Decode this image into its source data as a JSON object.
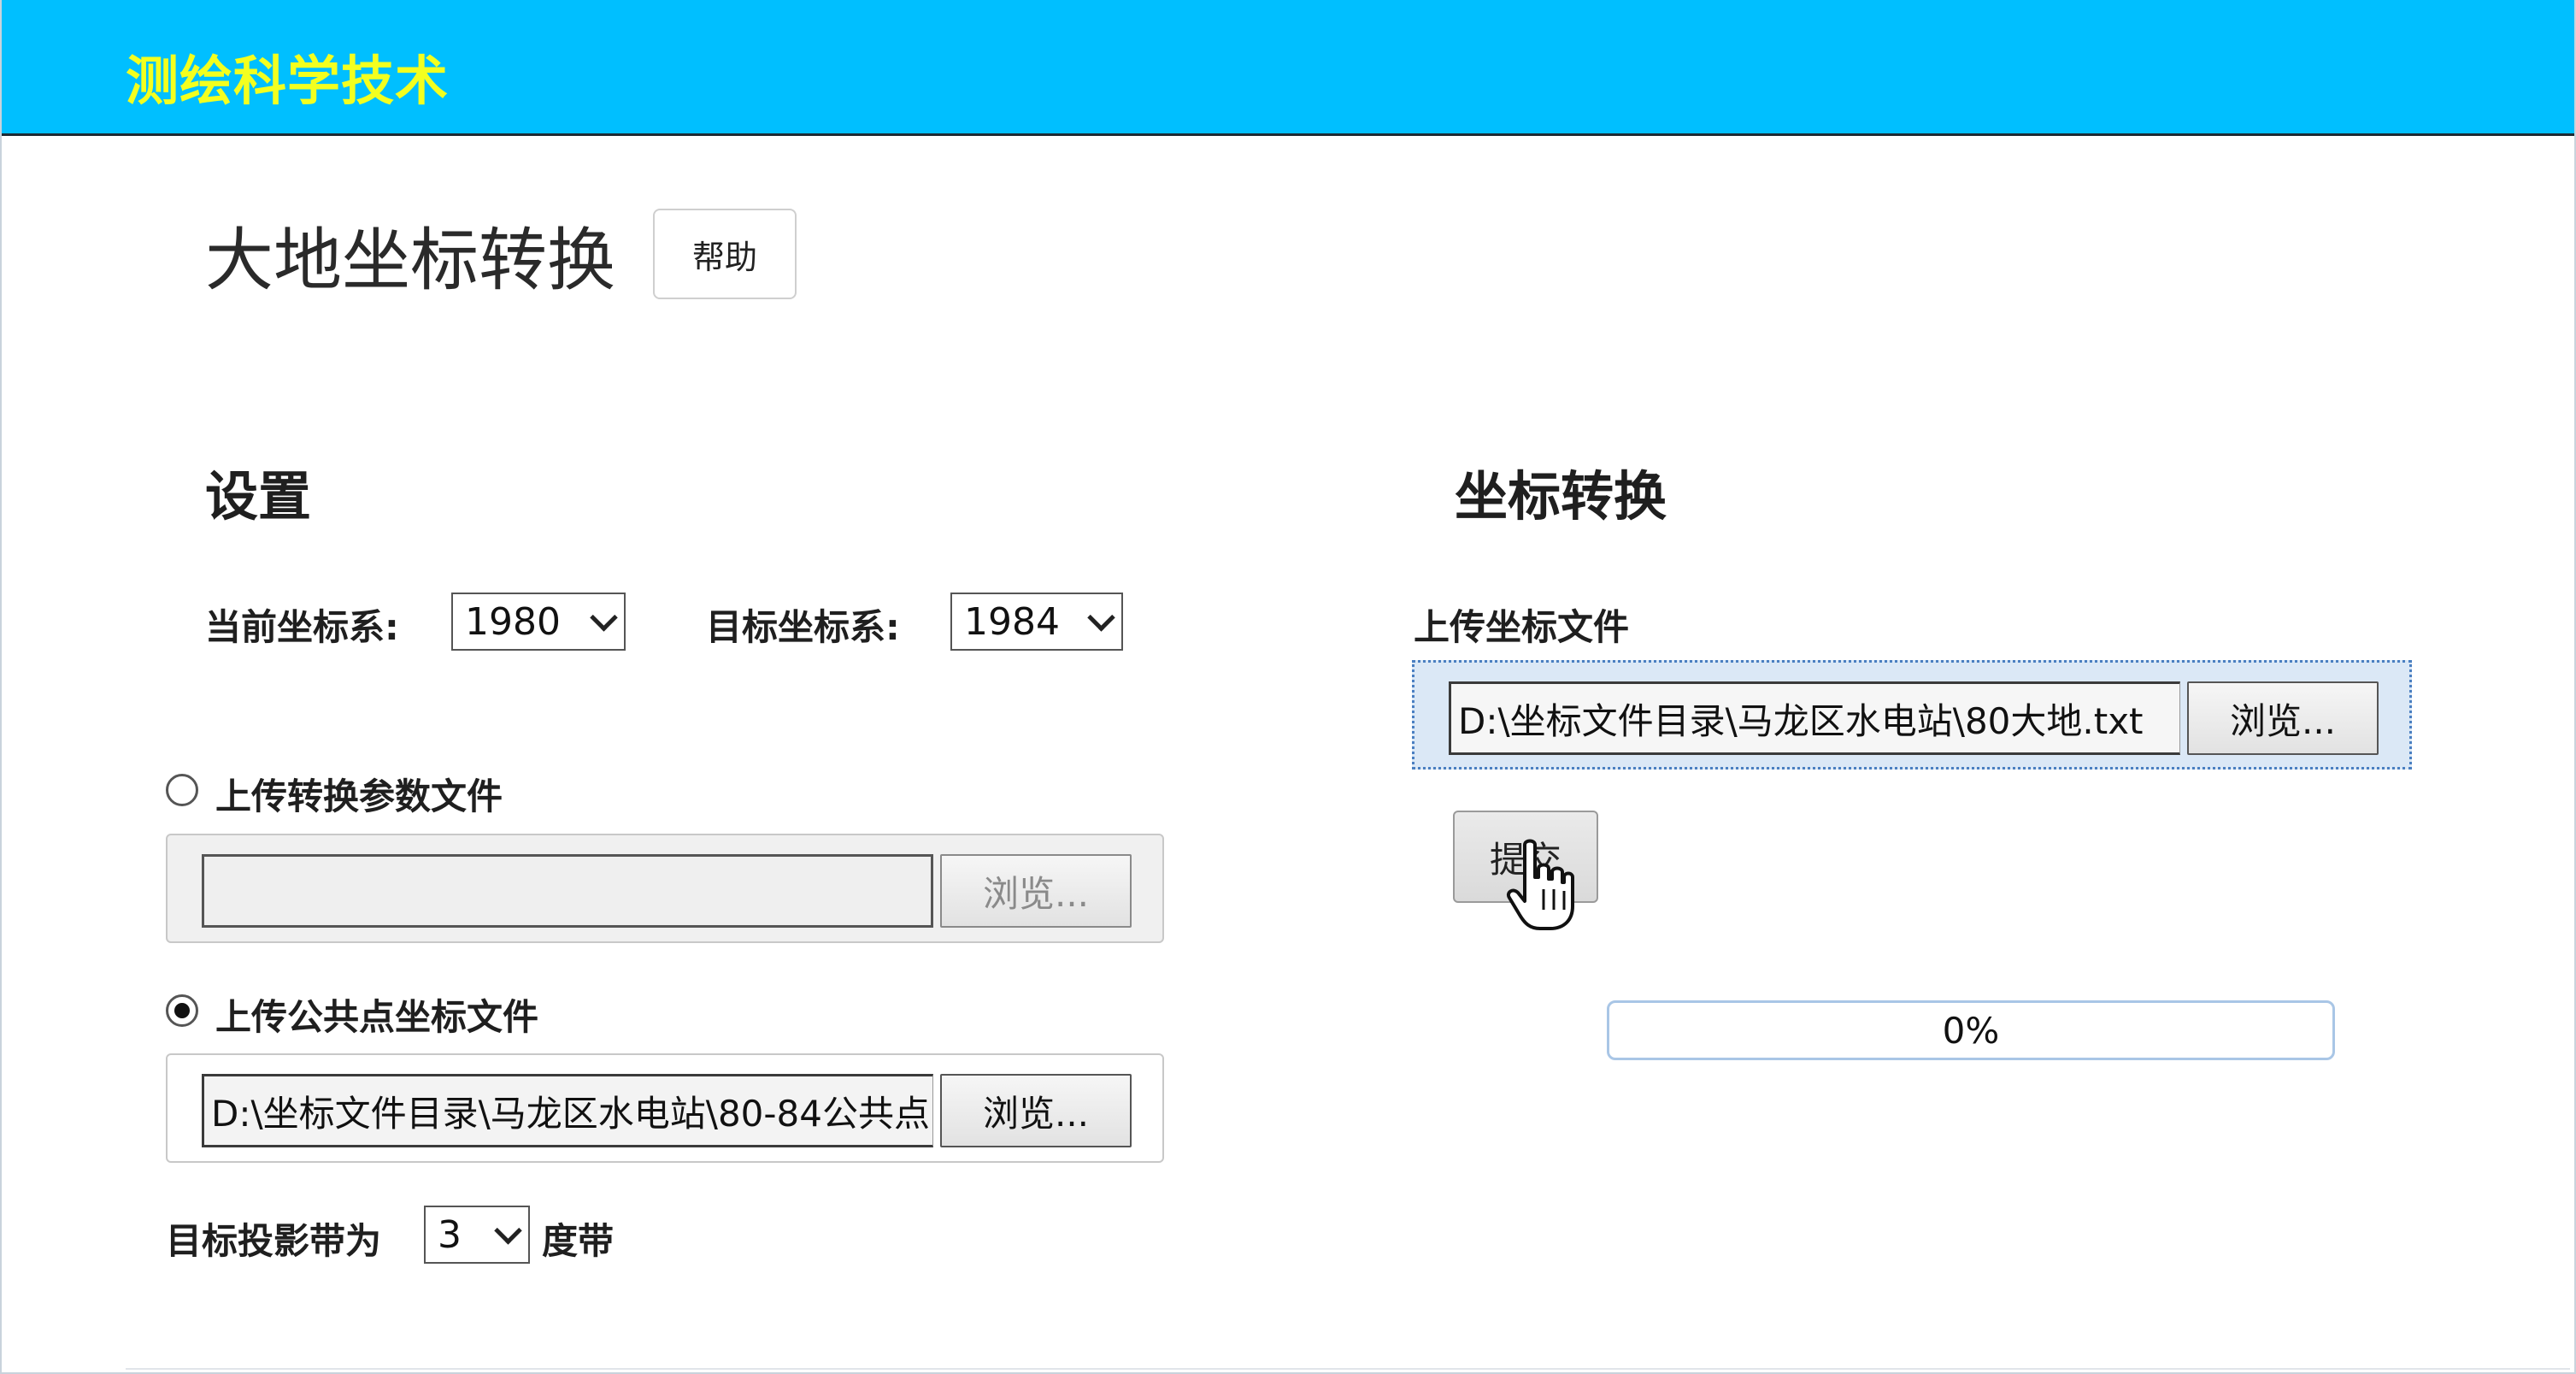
{
  "header": {
    "brand": "测绘科学技术"
  },
  "page": {
    "title": "大地坐标转换",
    "help_label": "帮助"
  },
  "settings": {
    "title": "设置",
    "current_crs_label": "当前坐标系:",
    "current_crs_value": "1980",
    "target_crs_label": "目标坐标系:",
    "target_crs_value": "1984",
    "param_file": {
      "label": "上传转换参数文件",
      "checked": false,
      "value": "",
      "browse_label": "浏览..."
    },
    "common_point_file": {
      "label": "上传公共点坐标文件",
      "checked": true,
      "value": "D:\\坐标文件目录\\马龙区水电站\\80-84公共点",
      "browse_label": "浏览..."
    },
    "zone_prefix": "目标投影带为",
    "zone_value": "3",
    "zone_suffix": "度带"
  },
  "convert": {
    "title": "坐标转换",
    "upload_label": "上传坐标文件",
    "file_value": "D:\\坐标文件目录\\马龙区水电站\\80大地.txt",
    "browse_label": "浏览...",
    "submit_label": "提交",
    "progress_text": "0%",
    "progress_fraction": 0
  },
  "icons": {
    "cursor": "hand-pointer-icon",
    "dropdown": "chevron-down-icon"
  },
  "colors": {
    "header_bg": "#00bfff",
    "brand_text": "#f3ff1f"
  }
}
